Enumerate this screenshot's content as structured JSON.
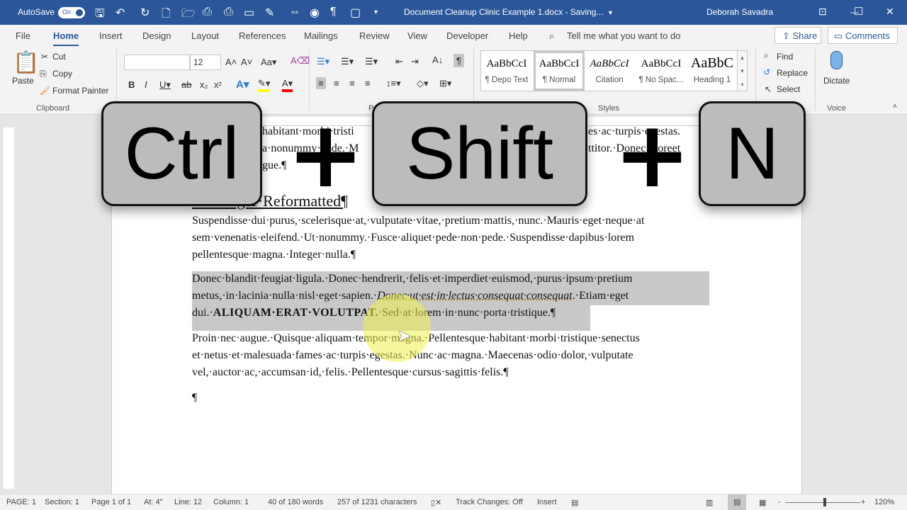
{
  "titlebar": {
    "autosave": "AutoSave",
    "toggle": "On",
    "doc_title": "Document Cleanup Clinic Example 1.docx  -  Saving...",
    "user": "Deborah Savadra",
    "minimize": "—",
    "maximize": "☐",
    "close": "✕"
  },
  "tabs": [
    "File",
    "Home",
    "Insert",
    "Design",
    "Layout",
    "References",
    "Mailings",
    "Review",
    "View",
    "Developer",
    "Help"
  ],
  "tell_me": "Tell me what you want to do",
  "share": "Share",
  "comments": "Comments",
  "clipboard": {
    "paste": "Paste",
    "cut": "Cut",
    "copy": "Copy",
    "format_painter": "Format Painter",
    "label": "Clipboard"
  },
  "font": {
    "name": "",
    "size": "12"
  },
  "paragraph_label": "Paragraph",
  "styles": {
    "items": [
      {
        "preview": "AaBbCcI",
        "label": "¶ Depo Text"
      },
      {
        "preview": "AaBbCcI",
        "label": "¶ Normal"
      },
      {
        "preview": "AaBbCcI",
        "label": "Citation"
      },
      {
        "preview": "AaBbCcI",
        "label": "¶ No Spac..."
      },
      {
        "preview": "AaBbC",
        "label": "Heading 1"
      }
    ],
    "label": "Styles",
    "selected": "¶ Normal"
  },
  "editing": {
    "find": "Find",
    "replace": "Replace",
    "select": "Select"
  },
  "voice": {
    "dictate": "Dictate",
    "label": "Voice"
  },
  "document": {
    "frag1": "habitant morbi tristi",
    "frag1b": "es ac turpis egestas.",
    "frag2": "a nonummy pede. M",
    "frag2b": "ttitor. Donec laoreet",
    "frag3": "gue.¶",
    "heading": "Heading 1 Reformatted¶",
    "p1": [
      "Suspendisse dui purus, scelerisque at, vulputate vitae, pretium mattis, nunc. Mauris eget neque at",
      "sem venenatis eleifend. Ut nonummy. Fusce aliquet pede non pede. Suspendisse dapibus lorem",
      "pellentesque magna. Integer nulla.¶"
    ],
    "p2a": "Donec blandit feugiat ligula. Donec hendrerit, felis et imperdiet euismod, purus ipsum pretium",
    "p2b1": "metus, in lacinia nulla nisl eget sapien. ",
    "p2b2": "Donec ut est in lectus consequat consequat",
    "p2b3": ". Etiam eget",
    "p2c1": "dui. ",
    "p2c2": "ALIQUAM ERAT VOLUTPAT.",
    "p2c3": " Sed at lorem in nunc porta tristique.¶",
    "p3": [
      "Proin nec augue. Quisque aliquam tempor magna. Pellentesque habitant morbi tristique senectus",
      "et netus et malesuada fames ac turpis egestas. Nunc ac magna. Maecenas odio dolor, vulputate",
      "vel, auctor ac, accumsan id, felis. Pellentesque cursus sagittis felis.¶"
    ],
    "p4": "¶"
  },
  "keys": {
    "k1": "Ctrl",
    "plus": "+",
    "k2": "Shift",
    "k3": "N"
  },
  "status": {
    "page": "PAGE: 1",
    "section": "Section: 1",
    "pages": "Page 1 of 1",
    "at": "At: 4\"",
    "line": "Line: 12",
    "column": "Column: 1",
    "words": "40 of 180 words",
    "chars": "257 of 1231 characters",
    "track": "Track Changes: Off",
    "mode": "Insert",
    "zoom": "120%"
  },
  "colors": {
    "brand": "#2b579a",
    "selection": "#c8c8c8",
    "highlight": "#ffff00",
    "font_color": "#ff0000"
  }
}
